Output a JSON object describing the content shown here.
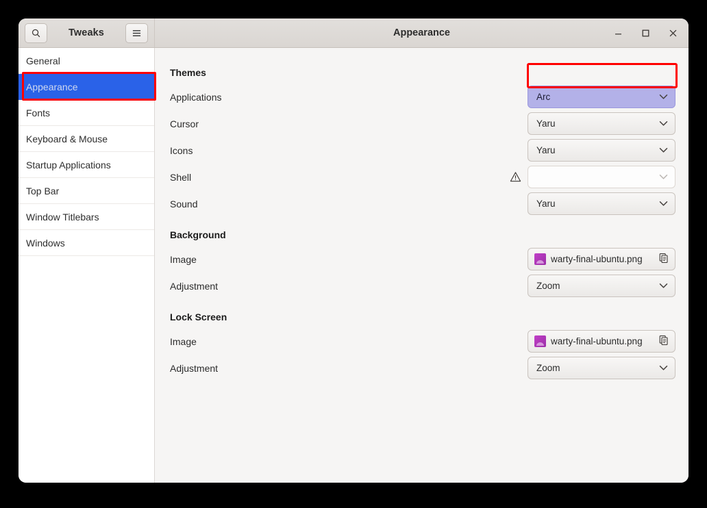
{
  "window": {
    "app_title": "Tweaks",
    "page_title": "Appearance",
    "search_icon": "search-icon",
    "menu_icon": "hamburger-menu-icon",
    "controls": [
      {
        "name": "minimize-button",
        "glyph": "minimize"
      },
      {
        "name": "maximize-button",
        "glyph": "maximize"
      },
      {
        "name": "close-button",
        "glyph": "close"
      }
    ]
  },
  "sidebar": {
    "items": [
      {
        "label": "General",
        "selected": false
      },
      {
        "label": "Appearance",
        "selected": true
      },
      {
        "label": "Fonts",
        "selected": false
      },
      {
        "label": "Keyboard & Mouse",
        "selected": false
      },
      {
        "label": "Startup Applications",
        "selected": false
      },
      {
        "label": "Top Bar",
        "selected": false
      },
      {
        "label": "Window Titlebars",
        "selected": false
      },
      {
        "label": "Windows",
        "selected": false
      }
    ]
  },
  "content": {
    "sections": [
      {
        "title": "Themes",
        "rows": [
          {
            "label": "Applications",
            "type": "combo",
            "value": "Arc",
            "highlighted": true,
            "disabled": false,
            "warning": false
          },
          {
            "label": "Cursor",
            "type": "combo",
            "value": "Yaru",
            "highlighted": false,
            "disabled": false,
            "warning": false
          },
          {
            "label": "Icons",
            "type": "combo",
            "value": "Yaru",
            "highlighted": false,
            "disabled": false,
            "warning": false
          },
          {
            "label": "Shell",
            "type": "combo",
            "value": "",
            "highlighted": false,
            "disabled": true,
            "warning": true
          },
          {
            "label": "Sound",
            "type": "combo",
            "value": "Yaru",
            "highlighted": false,
            "disabled": false,
            "warning": false
          }
        ]
      },
      {
        "title": "Background",
        "rows": [
          {
            "label": "Image",
            "type": "file",
            "value": "warty-final-ubuntu.png",
            "highlighted": false,
            "disabled": false,
            "warning": false
          },
          {
            "label": "Adjustment",
            "type": "combo",
            "value": "Zoom",
            "highlighted": false,
            "disabled": false,
            "warning": false
          }
        ]
      },
      {
        "title": "Lock Screen",
        "rows": [
          {
            "label": "Image",
            "type": "file",
            "value": "warty-final-ubuntu.png",
            "highlighted": false,
            "disabled": false,
            "warning": false
          },
          {
            "label": "Adjustment",
            "type": "combo",
            "value": "Zoom",
            "highlighted": false,
            "disabled": false,
            "warning": false
          }
        ]
      }
    ]
  },
  "annotations": {
    "sidebar_highlight_color": "#ff0000",
    "combo_highlight_color": "#ff0000",
    "selection_color": "#2a62e8",
    "combo_highlight_fill": "#b3b1e8"
  }
}
